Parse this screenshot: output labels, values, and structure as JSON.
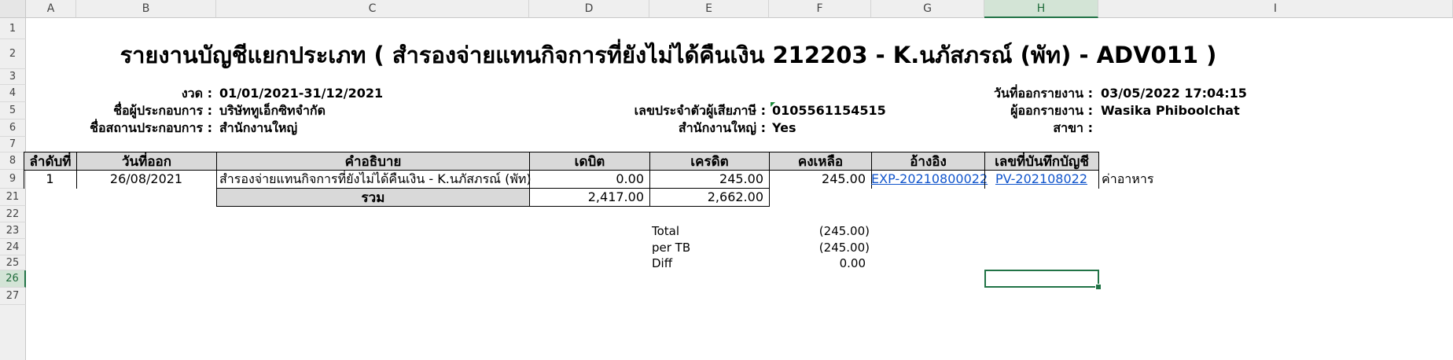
{
  "columns": [
    "A",
    "B",
    "C",
    "D",
    "E",
    "F",
    "G",
    "H",
    "I"
  ],
  "rows": [
    "1",
    "2",
    "3",
    "4",
    "5",
    "6",
    "7",
    "8",
    "9",
    "21",
    "22",
    "23",
    "24",
    "25",
    "26",
    "27"
  ],
  "report": {
    "title": "รายงานบัญชีแยกประเภท ( สำรองจ่ายแทนกิจการที่ยังไม่ได้คืนเงิน 212203 - K.นภัสภรณ์ (พัท) - ADV011 )",
    "period_label": "งวด :",
    "period_value": "01/01/2021-31/12/2021",
    "company_label": "ชื่อผู้ประกอบการ :",
    "company_value": "บริษัททูเอ็กซิทจำกัด",
    "place_label": "ชื่อสถานประกอบการ :",
    "place_value": "สำนักงานใหญ่",
    "taxid_label": "เลขประจำตัวผู้เสียภาษี :",
    "taxid_value": "0105561154515",
    "hq_label": "สำนักงานใหญ่ :",
    "hq_value": "Yes",
    "printdate_label": "วันที่ออกรายงาน :",
    "printdate_value": "03/05/2022 17:04:15",
    "printer_label": "ผู้ออกรายงาน :",
    "printer_value": "Wasika Phiboolchat",
    "branch_label": "สาขา :"
  },
  "table": {
    "headers": [
      "ลำดับที่",
      "วันที่ออก",
      "คำอธิบาย",
      "เดบิต",
      "เครดิต",
      "คงเหลือ",
      "อ้างอิง",
      "เลขที่บันทึกบัญชี"
    ],
    "row": {
      "no": "1",
      "date": "26/08/2021",
      "desc": "สำรองจ่ายแทนกิจการที่ยังไม่ได้คืนเงิน - K.นภัสภรณ์ (พัท)",
      "debit": "0.00",
      "credit": "245.00",
      "balance": "245.00",
      "ref": "EXP-20210800022",
      "voucher": "PV-202108022",
      "note": "ค่าอาหาร"
    },
    "total_label": "รวม",
    "total_debit": "2,417.00",
    "total_credit": "2,662.00"
  },
  "summary": {
    "total_label": "Total",
    "total_value": "(245.00)",
    "pertb_label": "per TB",
    "pertb_value": "(245.00)",
    "diff_label": "Diff",
    "diff_value": "0.00"
  }
}
